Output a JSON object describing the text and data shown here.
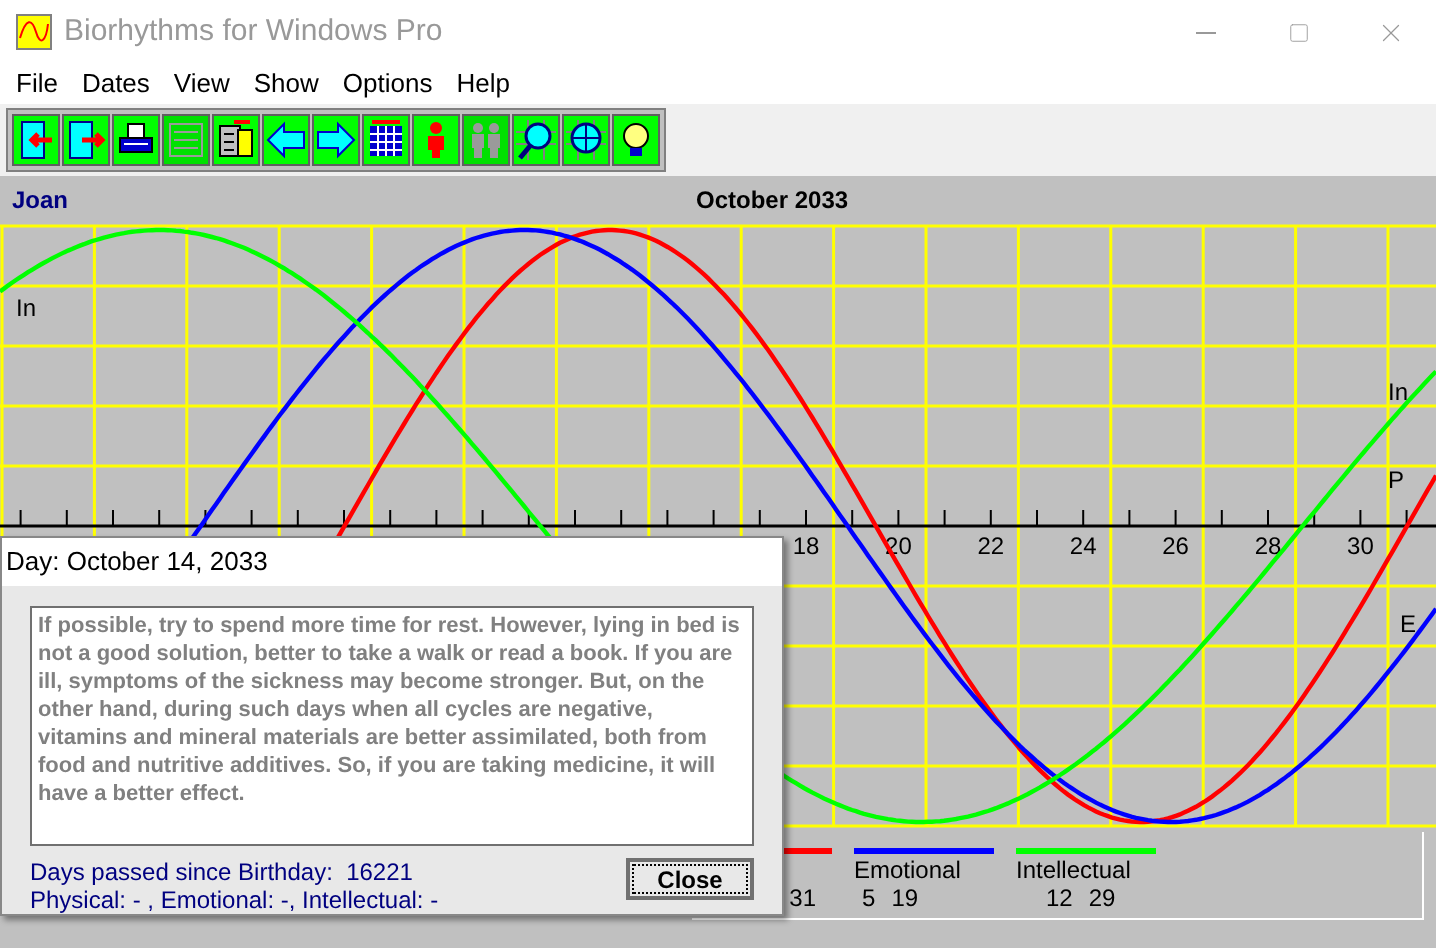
{
  "window": {
    "title": "Biorhythms for Windows Pro"
  },
  "menu": [
    "File",
    "Dates",
    "View",
    "Show",
    "Options",
    "Help"
  ],
  "toolbar": [
    {
      "kind": "exit-left",
      "disabled": false
    },
    {
      "kind": "exit-right",
      "disabled": false
    },
    {
      "kind": "printer",
      "disabled": false
    },
    {
      "kind": "list",
      "disabled": true
    },
    {
      "kind": "database",
      "disabled": false
    },
    {
      "kind": "arrow-left",
      "disabled": false
    },
    {
      "kind": "arrow-right",
      "disabled": false
    },
    {
      "kind": "calendar",
      "disabled": false
    },
    {
      "kind": "person",
      "disabled": false
    },
    {
      "kind": "people",
      "disabled": true
    },
    {
      "kind": "magnifier",
      "disabled": false
    },
    {
      "kind": "globe",
      "disabled": false
    },
    {
      "kind": "bulb",
      "disabled": false
    }
  ],
  "chart": {
    "person": "Joan",
    "title": "October 2033",
    "day_labels": [
      "18",
      "20",
      "22",
      "24",
      "26",
      "28",
      "30"
    ],
    "curve_labels": [
      "In",
      "In",
      "P",
      "E"
    ]
  },
  "legend": [
    {
      "color": "#ff0000",
      "numbers": [
        "31"
      ]
    },
    {
      "name": "Emotional",
      "color": "#0000ff",
      "numbers": [
        "5",
        "19"
      ]
    },
    {
      "name": "Intellectual",
      "color": "#00ff00",
      "numbers": [
        "12",
        "29"
      ]
    }
  ],
  "dialog": {
    "title": "Day: October 14, 2033",
    "text": "If possible, try to spend more time for rest. However, lying in bed is not a good solution, better to take a walk or read a book. If you are ill, symptoms of the sickness may become stronger. But, on the other hand, during such days when all cycles are negative, vitamins and mineral materials are better assimilated, both from food and nutritive additives. So, if you are taking medicine, it will have a better effect.",
    "days_passed": "Days passed since Birthday:  16221",
    "cycles": "Physical: - , Emotional: -, Intellectual: -",
    "button": "Close"
  }
}
